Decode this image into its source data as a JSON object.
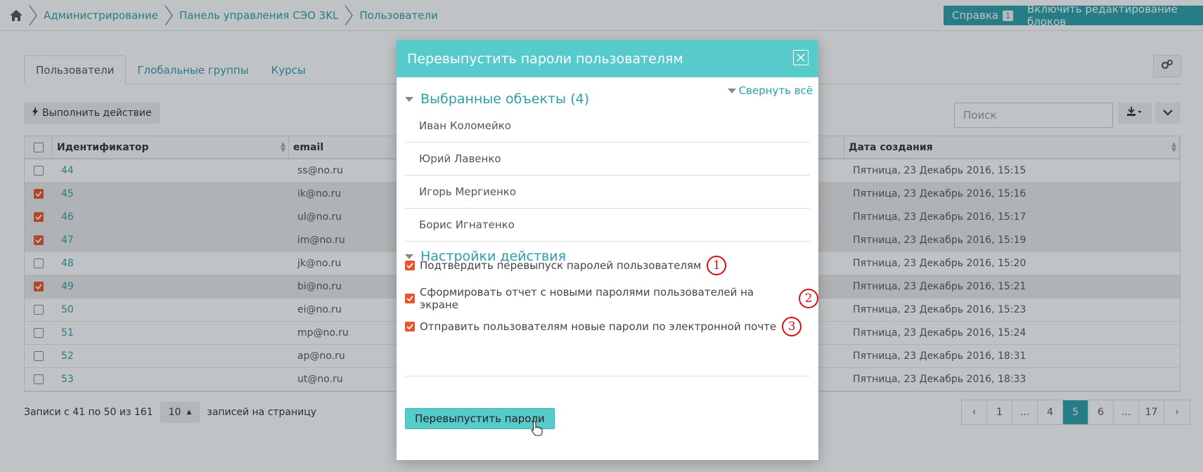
{
  "breadcrumb": {
    "items": [
      "Администрирование",
      "Панель управления СЭО 3KL",
      "Пользователи"
    ]
  },
  "top_buttons": {
    "help_label": "Справка",
    "help_badge": "1",
    "edit_blocks_label": "Включить редактирование блоков"
  },
  "tabs": [
    "Пользователи",
    "Глобальные группы",
    "Курсы"
  ],
  "toolbar": {
    "action_label": "Выполнить действие",
    "search_placeholder": "Поиск"
  },
  "table": {
    "columns": [
      "Идентификатор",
      "email",
      "Дата создания"
    ],
    "rows": [
      {
        "id": "44",
        "email": "ss@no.ru",
        "date": "Пятница, 23 Декабрь 2016, 15:15",
        "checked": false
      },
      {
        "id": "45",
        "email": "ik@no.ru",
        "date": "Пятница, 23 Декабрь 2016, 15:16",
        "checked": true
      },
      {
        "id": "46",
        "email": "ul@no.ru",
        "date": "Пятница, 23 Декабрь 2016, 15:17",
        "checked": true
      },
      {
        "id": "47",
        "email": "im@no.ru",
        "date": "Пятница, 23 Декабрь 2016, 15:19",
        "checked": true
      },
      {
        "id": "48",
        "email": "jk@no.ru",
        "date": "Пятница, 23 Декабрь 2016, 15:20",
        "checked": false
      },
      {
        "id": "49",
        "email": "bi@no.ru",
        "date": "Пятница, 23 Декабрь 2016, 15:21",
        "checked": true
      },
      {
        "id": "50",
        "email": "ei@no.ru",
        "date": "Пятница, 23 Декабрь 2016, 15:23",
        "checked": false
      },
      {
        "id": "51",
        "email": "mp@no.ru",
        "date": "Пятница, 23 Декабрь 2016, 15:24",
        "checked": false
      },
      {
        "id": "52",
        "email": "ap@no.ru",
        "date": "Пятница, 23 Декабрь 2016, 18:31",
        "checked": false
      },
      {
        "id": "53",
        "email": "ut@no.ru",
        "date": "Пятница, 23 Декабрь 2016, 18:33",
        "checked": false
      }
    ]
  },
  "footer": {
    "records_label": "Записи с 41 по 50 из 161",
    "per_page_value": "10",
    "per_page_suffix": "записей на страницу"
  },
  "pagination": [
    "‹",
    "1",
    "...",
    "4",
    "5",
    "6",
    "...",
    "17",
    "›"
  ],
  "pagination_active": "5",
  "modal": {
    "title": "Перевыпустить пароли пользователям",
    "collapse_all": "Свернуть всё",
    "selected_title": "Выбранные объекты (4)",
    "selected_items": [
      "Иван Коломейко",
      "Юрий Лавенко",
      "Игорь Мергиенко",
      "Борис Игнатенко"
    ],
    "settings_title": "Настройки действия",
    "options": [
      {
        "label": "Подтвердить перевыпуск паролей пользователям",
        "marker": "1",
        "checked": true
      },
      {
        "label": "Сформировать отчет с новыми паролями пользователей на экране",
        "marker": "2",
        "checked": true
      },
      {
        "label": "Отправить пользователям новые пароли по электронной почте",
        "marker": "3",
        "checked": true
      }
    ],
    "submit_label": "Перевыпустить пароли"
  },
  "colors": {
    "accent": "#2a9ea8",
    "modal_header": "#57cbcc",
    "checkbox_checked": "#e8562e",
    "annotation_red": "#d41111"
  }
}
